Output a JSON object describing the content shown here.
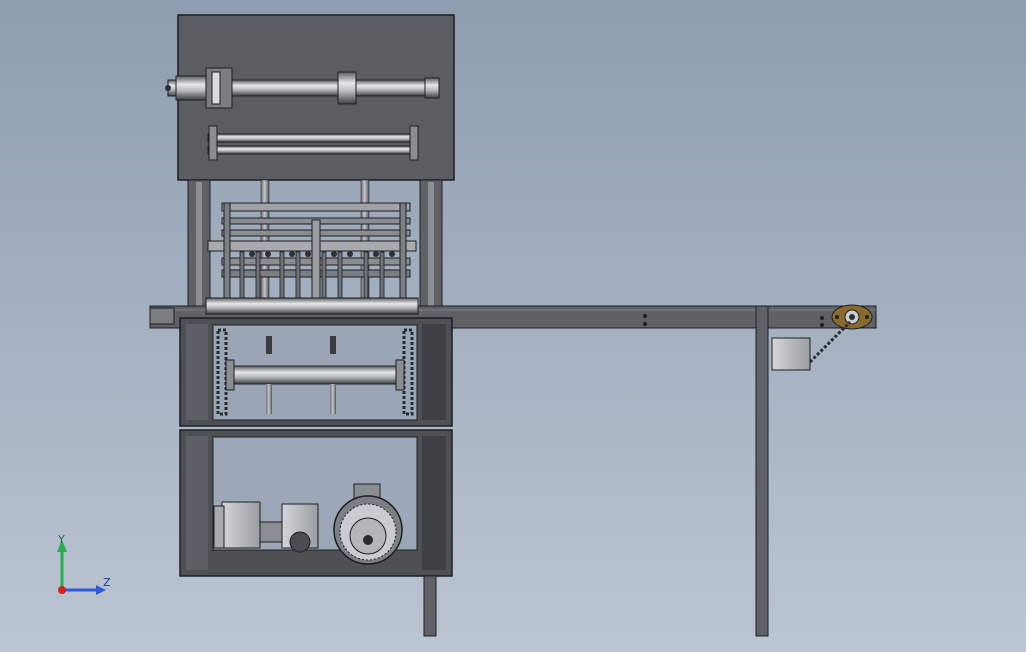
{
  "viewport": {
    "background_top": "#8d9db0",
    "background_bottom": "#bcc5d2"
  },
  "model": {
    "frame_color": "#5f6166",
    "panel_color": "#4e5054",
    "steel_light": "#c9ccd0",
    "steel_dark": "#3a3c40",
    "edge_color": "#1d1f22"
  },
  "triad": {
    "y_label": "Y",
    "z_label": "Z",
    "y_color": "#22b14c",
    "z_color": "#2e5bd8",
    "x_color": "#d02020"
  }
}
